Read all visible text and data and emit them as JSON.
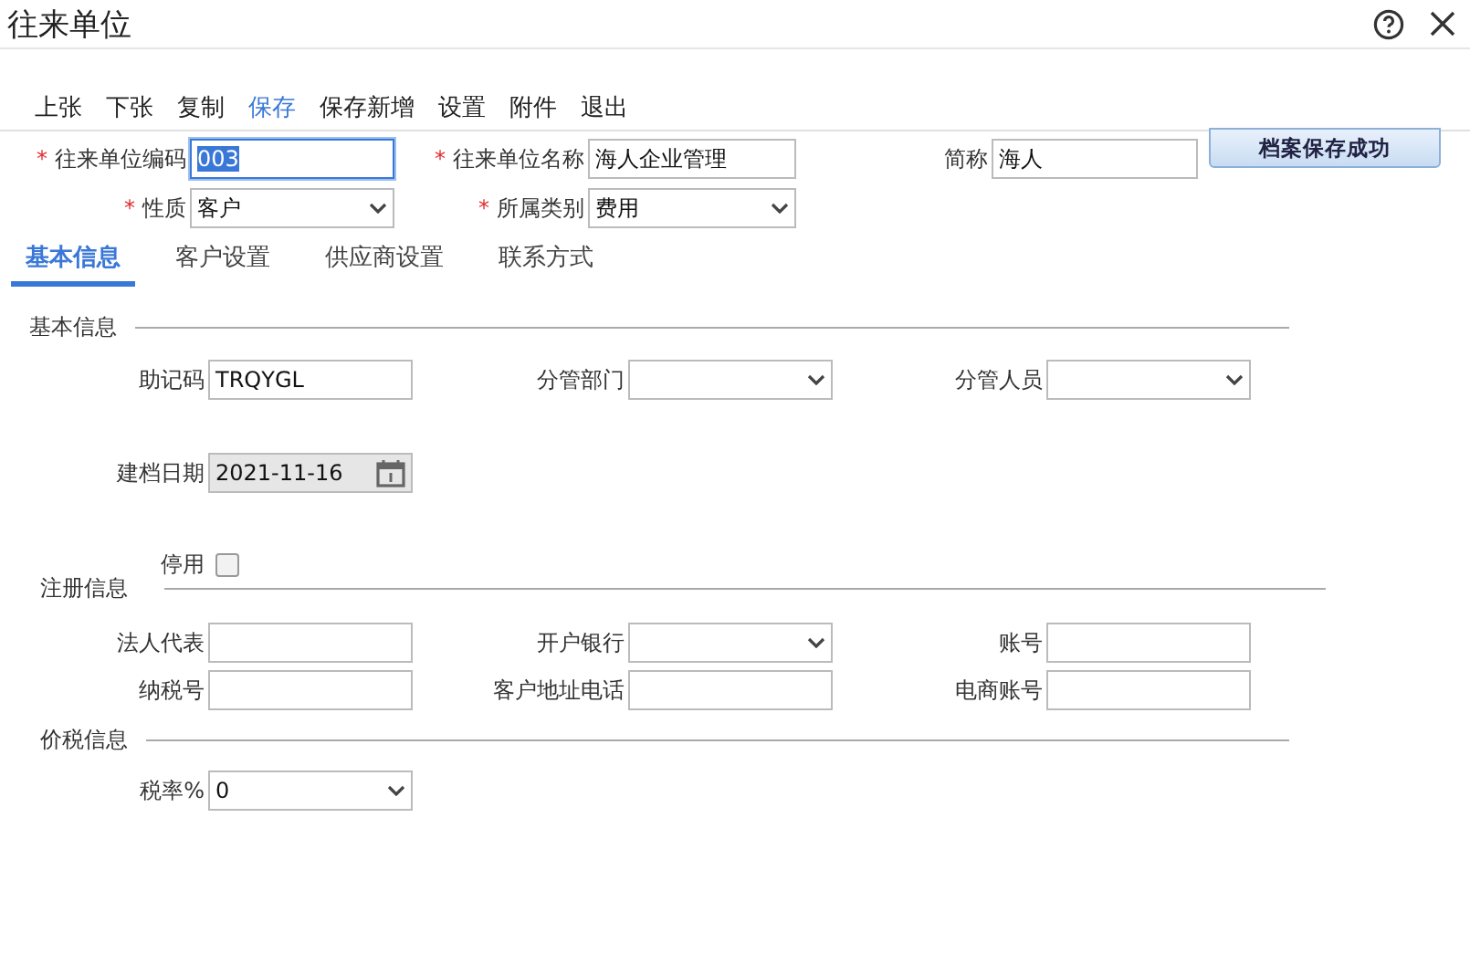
{
  "window": {
    "title": "往来单位"
  },
  "toolbar": [
    {
      "label": "上张",
      "selected": false
    },
    {
      "label": "下张",
      "selected": false
    },
    {
      "label": "复制",
      "selected": false
    },
    {
      "label": "保存",
      "selected": true
    },
    {
      "label": "保存新增",
      "selected": false
    },
    {
      "label": "设置",
      "selected": false
    },
    {
      "label": "附件",
      "selected": false
    },
    {
      "label": "退出",
      "selected": false
    }
  ],
  "header_fields": [
    {
      "required_mark": "*",
      "label": "往来单位编码",
      "kind": "text",
      "value": "003",
      "focused": true
    },
    {
      "required_mark": "*",
      "label": "往来单位名称",
      "kind": "text",
      "value": "海人企业管理",
      "focused": false
    },
    {
      "label": "简称",
      "kind": "text",
      "value": "海人",
      "focused": false
    },
    {
      "required_mark": "*",
      "label": "性质",
      "kind": "select",
      "value": "客户"
    },
    {
      "required_mark": "*",
      "label": "所属类别",
      "kind": "select",
      "value": "费用"
    }
  ],
  "notice": "档案保存成功",
  "tabs": [
    {
      "label": "基本信息",
      "selected": true
    },
    {
      "label": "客户设置",
      "selected": false
    },
    {
      "label": "供应商设置",
      "selected": false
    },
    {
      "label": "联系方式",
      "selected": false
    }
  ],
  "sections": [
    {
      "title": "基本信息",
      "rows": [
        [
          {
            "label": "助记码",
            "kind": "text",
            "value": "TRQYGL"
          },
          {
            "label": "分管部门",
            "kind": "select"
          },
          {
            "label": "分管人员",
            "kind": "select"
          }
        ],
        [
          {
            "label": "建档日期",
            "kind": "date",
            "value": "2021-11-16",
            "disabled": true
          }
        ],
        [
          {
            "label": "停用",
            "kind": "checkbox",
            "checked": false
          }
        ]
      ]
    },
    {
      "title": "注册信息",
      "rows": [
        [
          {
            "label": "法人代表",
            "kind": "text"
          },
          {
            "label": "开户银行",
            "kind": "select"
          },
          {
            "label": "账号",
            "kind": "text"
          }
        ],
        [
          {
            "label": "纳税号",
            "kind": "text"
          },
          {
            "label": "客户地址电话",
            "kind": "text"
          },
          {
            "label": "电商账号",
            "kind": "text"
          }
        ]
      ]
    },
    {
      "title": "价税信息",
      "rows": [
        [
          {
            "label": "税率%",
            "kind": "select",
            "value": "0"
          }
        ]
      ]
    }
  ]
}
